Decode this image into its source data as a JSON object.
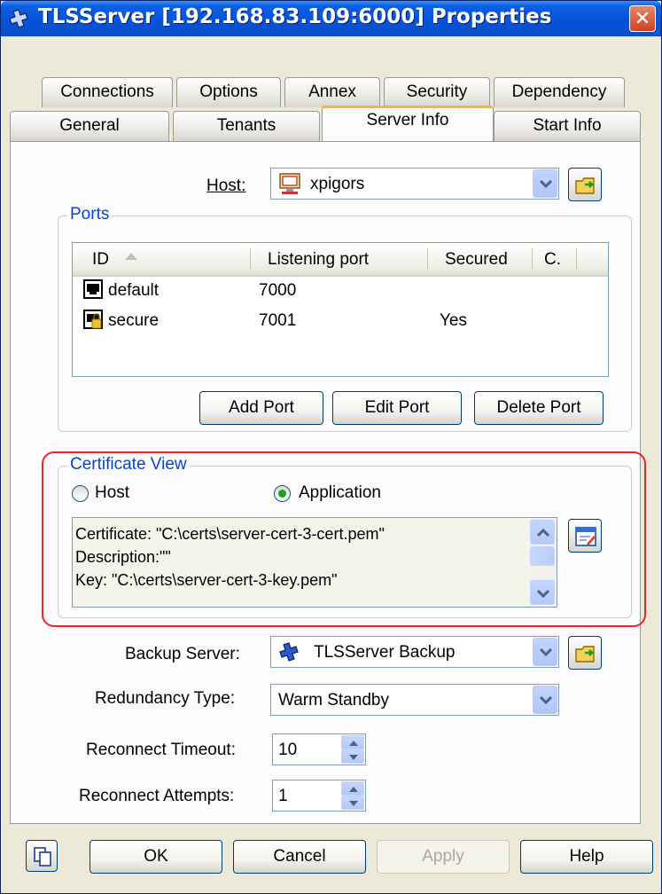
{
  "window": {
    "title": "TLSServer [192.168.83.109:6000] Properties",
    "close_label": "✕"
  },
  "tabs": {
    "row1": [
      "Connections",
      "Options",
      "Annex",
      "Security",
      "Dependency"
    ],
    "row2": [
      "General",
      "Tenants",
      "Server Info",
      "Start Info"
    ],
    "active": "Server Info"
  },
  "host": {
    "label": "Host:",
    "value": "xpigors"
  },
  "ports": {
    "group_title": "Ports",
    "columns": [
      "ID",
      "Listening port",
      "Secured",
      "C."
    ],
    "rows": [
      {
        "id": "default",
        "port": "7000",
        "secured": ""
      },
      {
        "id": "secure",
        "port": "7001",
        "secured": "Yes"
      }
    ],
    "buttons": {
      "add": "Add Port",
      "edit": "Edit Port",
      "delete": "Delete Port"
    }
  },
  "certificate_view": {
    "group_title": "Certificate View",
    "radio_host": "Host",
    "radio_application": "Application",
    "selected": "Application",
    "lines": [
      "Certificate: \"C:\\certs\\server-cert-3-cert.pem\"",
      "Description:\"\"",
      "Key: \"C:\\certs\\server-cert-3-key.pem\""
    ]
  },
  "backup_server": {
    "label": "Backup Server:",
    "value": "TLSServer Backup"
  },
  "redundancy_type": {
    "label": "Redundancy Type:",
    "value": "Warm Standby"
  },
  "reconnect_timeout": {
    "label": "Reconnect Timeout:",
    "value": "10"
  },
  "reconnect_attempts": {
    "label": "Reconnect Attempts:",
    "value": "1"
  },
  "footer": {
    "ok": "OK",
    "cancel": "Cancel",
    "apply": "Apply",
    "help": "Help"
  },
  "colors": {
    "accent": "#0046d5",
    "highlight": "#e8262a",
    "active_tab": "#f9b632"
  },
  "icons": [
    "server-icon",
    "close-icon",
    "host-icon",
    "folder-icon",
    "sort-up-icon",
    "port-icon",
    "secure-port-icon",
    "edit-certificate-icon",
    "copy-icon"
  ]
}
